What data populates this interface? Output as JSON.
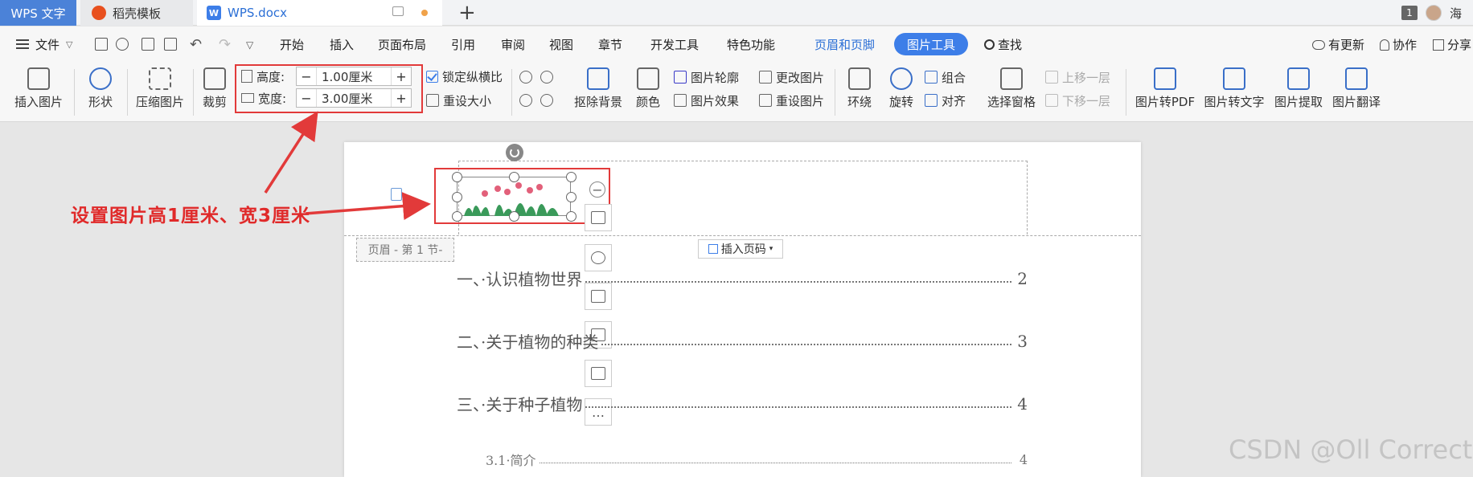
{
  "tabs": {
    "wps": "WPS 文字",
    "template": "稻壳模板",
    "doc": "WPS.docx",
    "new": "+"
  },
  "topright": {
    "badge": "1",
    "user": "海"
  },
  "menu": {
    "file": "文件",
    "items": [
      "开始",
      "插入",
      "页面布局",
      "引用",
      "审阅",
      "视图",
      "章节",
      "开发工具",
      "特色功能"
    ],
    "header_footer": "页眉和页脚",
    "picture_tools": "图片工具",
    "search": "查找",
    "update": "有更新",
    "collab": "协作",
    "share": "分享"
  },
  "ribbon": {
    "insert_picture": "插入图片",
    "shape": "形状",
    "compress": "压缩图片",
    "crop": "裁剪",
    "height_label": "高度:",
    "height_value": "1.00厘米",
    "width_label": "宽度:",
    "width_value": "3.00厘米",
    "lock_ratio": "锁定纵横比",
    "reset_size": "重设大小",
    "remove_bg": "抠除背景",
    "color": "颜色",
    "outline": "图片轮廓",
    "effect": "图片效果",
    "change_pic": "更改图片",
    "reset_pic": "重设图片",
    "wrap": "环绕",
    "rotate": "旋转",
    "group": "组合",
    "align": "对齐",
    "select_pane": "选择窗格",
    "bring_forward": "上移一层",
    "send_backward": "下移一层",
    "to_pdf": "图片转PDF",
    "to_text": "图片转文字",
    "extract": "图片提取",
    "translate": "图片翻译",
    "minus": "−",
    "plus": "+"
  },
  "document": {
    "header_tag": "页眉 - 第 1 节-",
    "insert_page_num": "插入页码",
    "toc": [
      {
        "text": "一、·认识植物世界",
        "page": "2"
      },
      {
        "text": "二、·关于植物的种类",
        "page": "3"
      },
      {
        "text": "三、·关于种子植物",
        "page": "4"
      },
      {
        "text": "3.1·简介",
        "page": "4"
      }
    ],
    "more": "…"
  },
  "annotation": "设置图片高1厘米、宽3厘米",
  "watermark": "CSDN @Oll Correct",
  "colors": {
    "accent": "#3d7ee8",
    "annotation_red": "#e23a3a"
  }
}
